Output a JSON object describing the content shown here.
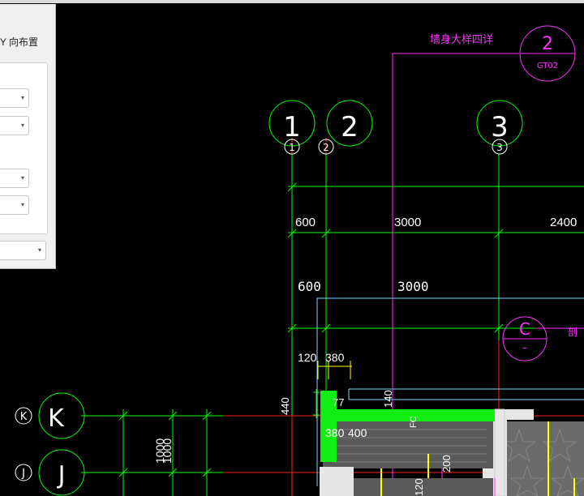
{
  "panel": {
    "heading": "Y 向布置",
    "dropdowns": [
      {
        "name": "dropdown-1",
        "value": ""
      },
      {
        "name": "dropdown-2",
        "value": ""
      },
      {
        "name": "dropdown-3",
        "value": ""
      },
      {
        "name": "dropdown-4",
        "value": ""
      },
      {
        "name": "dropdown-5",
        "value": ""
      }
    ],
    "dropdown_arrow": "▾"
  },
  "drawing": {
    "detail_title": "墙身大样四详",
    "detail_number": "2",
    "detail_sheet": "GT02",
    "section_mark": "C",
    "section_sub": "–",
    "partial_label": "剖",
    "axes_vertical": [
      {
        "label": "1",
        "small": "1"
      },
      {
        "label": "2",
        "small": "2"
      },
      {
        "label": "3",
        "small": "3"
      }
    ],
    "axes_horizontal": [
      {
        "label": "K",
        "small": "K"
      },
      {
        "label": "J",
        "small": "J"
      }
    ],
    "dims_top": [
      "600",
      "3000",
      "2400"
    ],
    "dims_second": [
      "600",
      "3000"
    ],
    "dim_120": "120",
    "dim_380": "380",
    "dim_440": "440",
    "dim_140": "140",
    "dim_77": "77",
    "dim_380b": "380",
    "dim_400": "400",
    "dim_200": "200",
    "dim_120b": "120",
    "dim_1000a": "1000",
    "dim_1000b": "1000",
    "fc": "FC",
    "colors": {
      "green": "#00ff00",
      "magenta": "#ff33ff",
      "red": "#ff2020",
      "cyan": "#7fd8ff",
      "yellow": "#ffff00",
      "gray_fill": "#8a8a8a",
      "white": "#ffffff"
    }
  }
}
